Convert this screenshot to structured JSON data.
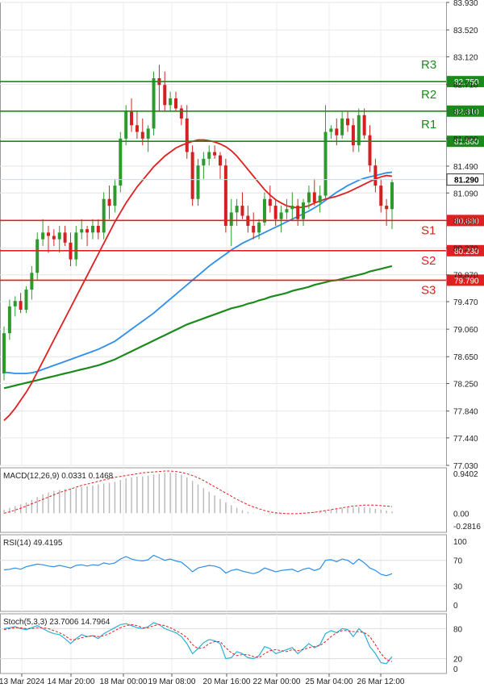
{
  "chart_data": {
    "type": "candlestick",
    "instrument_note": "",
    "price_ticks": [
      "83.930",
      "83.520",
      "83.120",
      "82.710",
      "82.310",
      "81.900",
      "81.490",
      "81.090",
      "80.680",
      "80.270",
      "79.870",
      "79.470",
      "79.060",
      "78.650",
      "78.250",
      "77.840",
      "77.440",
      "77.030"
    ],
    "y_range": [
      77.03,
      83.93
    ],
    "levels": [
      {
        "name": "R3",
        "value": 82.75,
        "label": "82.750",
        "color": "#1a8a1a"
      },
      {
        "name": "R2",
        "value": 82.31,
        "label": "82.310",
        "color": "#1a8a1a"
      },
      {
        "name": "R1",
        "value": 81.86,
        "label": "81.860",
        "color": "#1a8a1a"
      },
      {
        "name": "S1",
        "value": 80.68,
        "label": "80.680",
        "color": "#e02020"
      },
      {
        "name": "S2",
        "value": 80.23,
        "label": "80.230",
        "color": "#e02020"
      },
      {
        "name": "S3",
        "value": 79.79,
        "label": "79.790",
        "color": "#e02020"
      }
    ],
    "current_price": {
      "value": 81.29,
      "label": "81.290"
    },
    "x_labels": [
      "13 Mar 2024",
      "14 Mar 20:00",
      "18 Mar 00:00",
      "19 Mar 08:00",
      "20 Mar 16:00",
      "22 Mar 00:00",
      "25 Mar 04:00",
      "26 Mar 12:00"
    ],
    "candles": [
      [
        78.4,
        79.1,
        78.3,
        79.0
      ],
      [
        79.0,
        79.5,
        78.9,
        79.4
      ],
      [
        79.4,
        79.55,
        79.25,
        79.48
      ],
      [
        79.48,
        79.6,
        79.3,
        79.35
      ],
      [
        79.35,
        79.7,
        79.3,
        79.65
      ],
      [
        79.65,
        80.0,
        79.5,
        79.9
      ],
      [
        79.9,
        80.5,
        79.8,
        80.4
      ],
      [
        80.4,
        80.7,
        80.3,
        80.5
      ],
      [
        80.5,
        80.6,
        80.2,
        80.45
      ],
      [
        80.45,
        80.55,
        80.3,
        80.4
      ],
      [
        80.4,
        80.6,
        80.2,
        80.5
      ],
      [
        80.5,
        80.6,
        80.3,
        80.35
      ],
      [
        80.35,
        80.5,
        80.0,
        80.1
      ],
      [
        80.1,
        80.6,
        80.0,
        80.5
      ],
      [
        80.5,
        80.7,
        80.4,
        80.55
      ],
      [
        80.55,
        80.6,
        80.3,
        80.5
      ],
      [
        80.5,
        80.7,
        80.4,
        80.6
      ],
      [
        80.6,
        80.7,
        80.4,
        80.5
      ],
      [
        80.5,
        81.1,
        80.4,
        81.0
      ],
      [
        81.0,
        81.2,
        80.7,
        80.9
      ],
      [
        80.9,
        81.3,
        80.8,
        81.2
      ],
      [
        81.2,
        82.0,
        81.1,
        81.9
      ],
      [
        81.9,
        82.4,
        81.8,
        82.3
      ],
      [
        82.3,
        82.5,
        82.0,
        82.1
      ],
      [
        82.1,
        82.3,
        81.9,
        82.0
      ],
      [
        82.0,
        82.2,
        81.8,
        81.9
      ],
      [
        81.9,
        82.1,
        81.7,
        82.05
      ],
      [
        82.05,
        82.9,
        81.95,
        82.8
      ],
      [
        82.8,
        83.0,
        82.3,
        82.7
      ],
      [
        82.7,
        82.9,
        82.3,
        82.4
      ],
      [
        82.4,
        82.6,
        82.3,
        82.5
      ],
      [
        82.5,
        82.6,
        82.3,
        82.35
      ],
      [
        82.35,
        82.4,
        82.1,
        82.2
      ],
      [
        82.2,
        82.4,
        81.6,
        81.7
      ],
      [
        81.7,
        81.8,
        80.9,
        81.0
      ],
      [
        81.0,
        81.6,
        80.9,
        81.5
      ],
      [
        81.5,
        81.7,
        81.3,
        81.6
      ],
      [
        81.6,
        81.8,
        81.5,
        81.7
      ],
      [
        81.7,
        81.8,
        81.6,
        81.65
      ],
      [
        81.65,
        81.7,
        81.3,
        81.5
      ],
      [
        81.5,
        81.6,
        80.5,
        80.6
      ],
      [
        80.6,
        81.0,
        80.3,
        80.8
      ],
      [
        80.8,
        81.0,
        80.6,
        80.9
      ],
      [
        80.9,
        81.1,
        80.7,
        80.75
      ],
      [
        80.75,
        80.9,
        80.5,
        80.6
      ],
      [
        80.6,
        80.8,
        80.4,
        80.5
      ],
      [
        80.5,
        80.7,
        80.4,
        80.65
      ],
      [
        80.65,
        81.1,
        80.6,
        81.0
      ],
      [
        81.0,
        81.2,
        80.8,
        80.9
      ],
      [
        80.9,
        81.0,
        80.6,
        80.7
      ],
      [
        80.7,
        80.9,
        80.5,
        80.8
      ],
      [
        80.8,
        81.0,
        80.7,
        80.85
      ],
      [
        80.85,
        81.1,
        80.7,
        80.9
      ],
      [
        80.9,
        81.0,
        80.6,
        80.7
      ],
      [
        80.7,
        81.0,
        80.6,
        80.95
      ],
      [
        80.95,
        81.2,
        80.85,
        81.1
      ],
      [
        81.1,
        81.3,
        80.9,
        80.95
      ],
      [
        80.95,
        81.2,
        80.8,
        81.05
      ],
      [
        81.05,
        82.4,
        81.0,
        82.0
      ],
      [
        82.0,
        82.1,
        81.9,
        82.05
      ],
      [
        82.05,
        82.2,
        81.8,
        81.95
      ],
      [
        81.95,
        82.3,
        81.9,
        82.2
      ],
      [
        82.2,
        82.3,
        82.0,
        82.1
      ],
      [
        82.1,
        82.2,
        81.7,
        81.8
      ],
      [
        81.8,
        82.35,
        81.7,
        82.25
      ],
      [
        82.25,
        82.35,
        81.9,
        81.95
      ],
      [
        81.95,
        82.1,
        81.4,
        81.5
      ],
      [
        81.5,
        81.6,
        81.1,
        81.2
      ],
      [
        81.2,
        81.3,
        80.8,
        80.9
      ],
      [
        80.9,
        81.0,
        80.6,
        80.85
      ],
      [
        80.85,
        81.3,
        80.55,
        81.25
      ]
    ],
    "ma_slow_red": [
      77.7,
      77.78,
      77.88,
      78.0,
      78.12,
      78.26,
      78.42,
      78.58,
      78.74,
      78.9,
      79.06,
      79.22,
      79.38,
      79.54,
      79.7,
      79.86,
      80.02,
      80.18,
      80.34,
      80.5,
      80.66,
      80.8,
      80.94,
      81.06,
      81.18,
      81.28,
      81.38,
      81.48,
      81.56,
      81.64,
      81.7,
      81.76,
      81.8,
      81.83,
      81.86,
      81.88,
      81.88,
      81.87,
      81.85,
      81.82,
      81.78,
      81.72,
      81.64,
      81.54,
      81.44,
      81.34,
      81.24,
      81.14,
      81.06,
      80.99,
      80.94,
      80.9,
      80.88,
      80.87,
      80.88,
      80.9,
      80.94,
      80.97,
      81.0,
      81.02,
      81.04,
      81.07,
      81.1,
      81.14,
      81.18,
      81.22,
      81.26,
      81.3,
      81.33,
      81.35,
      81.34
    ],
    "ma_blue": [
      78.42,
      78.41,
      78.4,
      78.4,
      78.4,
      78.41,
      78.43,
      78.46,
      78.49,
      78.52,
      78.55,
      78.58,
      78.61,
      78.64,
      78.67,
      78.7,
      78.73,
      78.76,
      78.8,
      78.84,
      78.88,
      78.94,
      79.0,
      79.06,
      79.12,
      79.18,
      79.24,
      79.3,
      79.37,
      79.44,
      79.51,
      79.58,
      79.65,
      79.72,
      79.79,
      79.86,
      79.93,
      80.0,
      80.06,
      80.12,
      80.18,
      80.24,
      80.29,
      80.34,
      80.38,
      80.42,
      80.46,
      80.5,
      80.54,
      80.58,
      80.62,
      80.66,
      80.7,
      80.74,
      80.78,
      80.82,
      80.87,
      80.92,
      80.98,
      81.04,
      81.1,
      81.15,
      81.2,
      81.24,
      81.28,
      81.31,
      81.33,
      81.35,
      81.37,
      81.39,
      81.4
    ],
    "ma_green": [
      78.18,
      78.2,
      78.22,
      78.24,
      78.26,
      78.28,
      78.3,
      78.32,
      78.34,
      78.36,
      78.38,
      78.4,
      78.42,
      78.44,
      78.46,
      78.48,
      78.5,
      78.52,
      78.55,
      78.58,
      78.61,
      78.65,
      78.69,
      78.73,
      78.77,
      78.81,
      78.85,
      78.89,
      78.93,
      78.97,
      79.01,
      79.05,
      79.09,
      79.13,
      79.16,
      79.19,
      79.22,
      79.25,
      79.28,
      79.31,
      79.34,
      79.37,
      79.39,
      79.41,
      79.44,
      79.46,
      79.49,
      79.51,
      79.54,
      79.56,
      79.58,
      79.6,
      79.63,
      79.65,
      79.67,
      79.69,
      79.72,
      79.74,
      79.76,
      79.78,
      79.79,
      79.81,
      79.83,
      79.85,
      79.87,
      79.89,
      79.92,
      79.94,
      79.96,
      79.98,
      80.0
    ],
    "macd": {
      "label": "MACD(12,26,9) 0.0331 0.1468",
      "ticks": [
        "0.9402",
        "0.00",
        "-0.2816"
      ],
      "range": [
        -0.2816,
        0.9402
      ],
      "hist": [
        0.08,
        0.12,
        0.16,
        0.2,
        0.24,
        0.3,
        0.36,
        0.42,
        0.46,
        0.5,
        0.52,
        0.54,
        0.55,
        0.56,
        0.58,
        0.6,
        0.62,
        0.64,
        0.66,
        0.68,
        0.7,
        0.74,
        0.78,
        0.8,
        0.82,
        0.82,
        0.84,
        0.86,
        0.88,
        0.9,
        0.9,
        0.89,
        0.86,
        0.8,
        0.72,
        0.64,
        0.56,
        0.48,
        0.4,
        0.32,
        0.24,
        0.18,
        0.12,
        0.07,
        0.03,
        0.01,
        0.0,
        -0.01,
        -0.02,
        -0.02,
        -0.02,
        -0.02,
        -0.01,
        0.0,
        0.01,
        0.02,
        0.03,
        0.04,
        0.06,
        0.08,
        0.1,
        0.11,
        0.12,
        0.13,
        0.14,
        0.13,
        0.12,
        0.1,
        0.08,
        0.06,
        0.04
      ],
      "signal": [
        0.0,
        0.03,
        0.07,
        0.11,
        0.16,
        0.21,
        0.26,
        0.31,
        0.36,
        0.41,
        0.46,
        0.5,
        0.54,
        0.58,
        0.62,
        0.65,
        0.68,
        0.71,
        0.74,
        0.77,
        0.8,
        0.82,
        0.84,
        0.86,
        0.88,
        0.9,
        0.91,
        0.92,
        0.93,
        0.94,
        0.94,
        0.93,
        0.91,
        0.88,
        0.84,
        0.79,
        0.73,
        0.66,
        0.59,
        0.52,
        0.45,
        0.38,
        0.31,
        0.25,
        0.19,
        0.14,
        0.1,
        0.06,
        0.03,
        0.01,
        0.0,
        -0.01,
        -0.01,
        -0.01,
        0.0,
        0.01,
        0.02,
        0.04,
        0.06,
        0.08,
        0.1,
        0.12,
        0.14,
        0.16,
        0.17,
        0.18,
        0.18,
        0.18,
        0.17,
        0.16,
        0.15
      ]
    },
    "rsi": {
      "label": "RSI(14) 49.4195",
      "ticks": [
        "100",
        "70",
        "30",
        "0"
      ],
      "range": [
        0,
        100
      ],
      "values": [
        55,
        56,
        58,
        56,
        60,
        62,
        64,
        63,
        61,
        60,
        62,
        60,
        58,
        62,
        63,
        61,
        63,
        62,
        66,
        64,
        66,
        72,
        76,
        72,
        70,
        69,
        71,
        78,
        74,
        70,
        72,
        69,
        67,
        60,
        52,
        58,
        60,
        62,
        61,
        58,
        50,
        54,
        56,
        53,
        51,
        49,
        52,
        58,
        55,
        52,
        54,
        55,
        56,
        52,
        56,
        58,
        54,
        57,
        70,
        71,
        68,
        72,
        70,
        64,
        72,
        66,
        58,
        54,
        48,
        46,
        49
      ]
    },
    "stoch": {
      "label": "Stoch(5,3,3) 23.7006 14.7964",
      "ticks": [
        "80",
        "20",
        "0"
      ],
      "range": [
        0,
        100
      ],
      "k": [
        80,
        82,
        84,
        80,
        78,
        82,
        86,
        80,
        74,
        70,
        68,
        60,
        50,
        60,
        68,
        64,
        66,
        60,
        70,
        76,
        82,
        88,
        90,
        86,
        82,
        80,
        84,
        92,
        88,
        80,
        76,
        72,
        64,
        50,
        30,
        40,
        52,
        58,
        56,
        50,
        20,
        22,
        34,
        30,
        22,
        20,
        26,
        44,
        40,
        30,
        34,
        38,
        42,
        30,
        40,
        50,
        42,
        48,
        70,
        76,
        72,
        80,
        78,
        64,
        80,
        70,
        44,
        30,
        12,
        10,
        24
      ],
      "d": [
        78,
        80,
        82,
        82,
        80,
        80,
        82,
        82,
        80,
        76,
        72,
        66,
        58,
        58,
        62,
        64,
        66,
        64,
        66,
        70,
        76,
        82,
        86,
        88,
        86,
        82,
        82,
        86,
        88,
        86,
        82,
        76,
        70,
        62,
        48,
        40,
        42,
        50,
        54,
        54,
        42,
        32,
        26,
        28,
        28,
        24,
        22,
        30,
        36,
        38,
        36,
        34,
        38,
        36,
        38,
        42,
        44,
        46,
        54,
        64,
        72,
        76,
        76,
        74,
        74,
        72,
        64,
        48,
        30,
        18,
        14
      ]
    }
  }
}
